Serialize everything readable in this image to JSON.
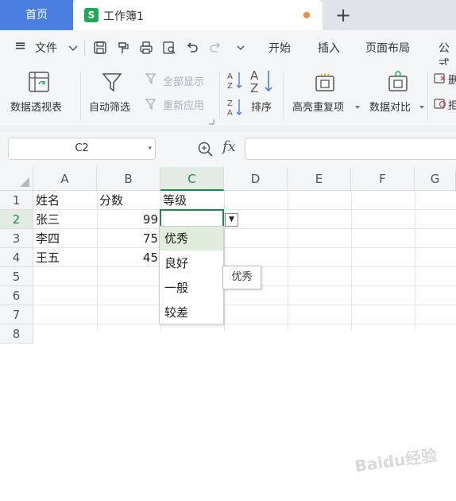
{
  "titlebar": {
    "home_tab": "首页",
    "doc_badge": "S",
    "doc_title": "工作簿1",
    "add_tab": "+"
  },
  "menubar": {
    "menu_icon": "≡",
    "file_label": "文件",
    "tabs": [
      "开始",
      "插入",
      "页面布局",
      "公式"
    ]
  },
  "ribbon": {
    "pivot": "数据透视表",
    "autofilter": "自动筛选",
    "show_all": "全部显示",
    "reapply": "重新应用",
    "sort": "排序",
    "highlight_dup": "高亮重复项",
    "compare": "数据对比",
    "more_a": "删",
    "more_b": "拒"
  },
  "formula": {
    "name_box": "C2",
    "fx": "fx",
    "content": ""
  },
  "sheet": {
    "columns": [
      "A",
      "B",
      "C",
      "D",
      "E",
      "F",
      "G"
    ],
    "rows": [
      "1",
      "2",
      "3",
      "4",
      "5",
      "6",
      "7",
      "8"
    ],
    "cells": {
      "A1": "姓名",
      "B1": "分数",
      "C1": "等级",
      "A2": "张三",
      "B2": "99",
      "A3": "李四",
      "B3": "75",
      "A4": "王五",
      "B4": "45"
    }
  },
  "dropdown": {
    "options": [
      "优秀",
      "良好",
      "一般",
      "较差"
    ],
    "tooltip": "优秀"
  },
  "watermark": "Baidu经验",
  "colors": {
    "accent_green": "#1d8a4a",
    "home_tab_blue": "#4a7fe0",
    "doc_badge_green": "#1faa59",
    "unsaved_dot": "#f08d3c"
  }
}
